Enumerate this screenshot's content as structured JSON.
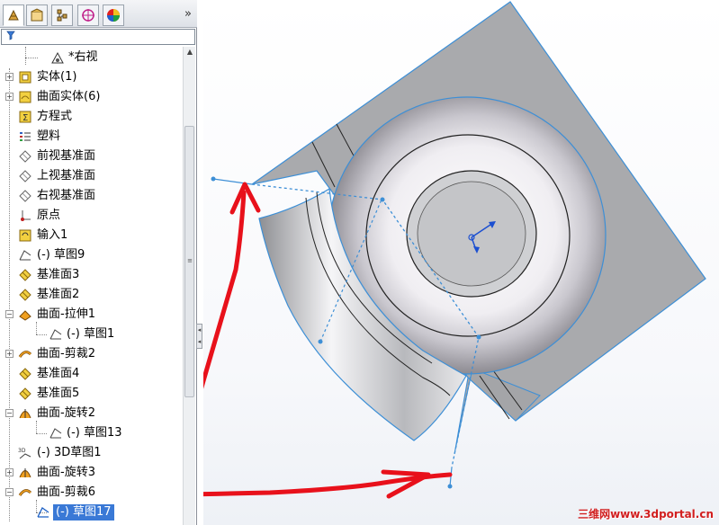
{
  "colors": {
    "selection": "#3a79d6",
    "surface_gray": "#a9aaad",
    "model_edge": "#3d8fd6",
    "annotation_red": "#e8111b"
  },
  "toolbar": {
    "tabs": [
      "feature-manager-icon",
      "property-manager-icon",
      "configuration-manager-icon",
      "dimxpert-icon",
      "display-manager-icon"
    ],
    "expand_glyph": "»"
  },
  "tree": {
    "items": [
      {
        "label": "*右视",
        "icon": "view-icon"
      },
      {
        "label": "实体(1)",
        "icon": "solid-bodies-icon"
      },
      {
        "label": "曲面实体(6)",
        "icon": "surface-bodies-icon"
      },
      {
        "label": "方程式",
        "icon": "equations-icon"
      },
      {
        "label": "塑料",
        "icon": "material-icon"
      },
      {
        "label": "前视基准面",
        "icon": "plane-icon"
      },
      {
        "label": "上视基准面",
        "icon": "plane-icon"
      },
      {
        "label": "右视基准面",
        "icon": "plane-icon"
      },
      {
        "label": "原点",
        "icon": "origin-icon"
      },
      {
        "label": "输入1",
        "icon": "import-icon"
      },
      {
        "label": "(-) 草图9",
        "icon": "sketch-icon"
      },
      {
        "label": "基准面3",
        "icon": "plane-icon"
      },
      {
        "label": "基准面2",
        "icon": "plane-icon"
      },
      {
        "label": "曲面-拉伸1",
        "icon": "surface-extrude-icon"
      },
      {
        "label": "(-) 草图1",
        "icon": "sketch-icon"
      },
      {
        "label": "曲面-剪裁2",
        "icon": "surface-trim-icon"
      },
      {
        "label": "基准面4",
        "icon": "plane-icon"
      },
      {
        "label": "基准面5",
        "icon": "plane-icon"
      },
      {
        "label": "曲面-旋转2",
        "icon": "surface-revolve-icon"
      },
      {
        "label": "(-) 草图13",
        "icon": "sketch-icon"
      },
      {
        "label": "(-) 3D草图1",
        "icon": "3d-sketch-icon"
      },
      {
        "label": "曲面-旋转3",
        "icon": "surface-revolve-icon"
      },
      {
        "label": "曲面-剪裁6",
        "icon": "surface-trim-icon"
      },
      {
        "label": "(-) 草图17",
        "icon": "sketch-icon",
        "selected": true
      }
    ]
  },
  "watermark": "三维网www.3dportal.cn"
}
